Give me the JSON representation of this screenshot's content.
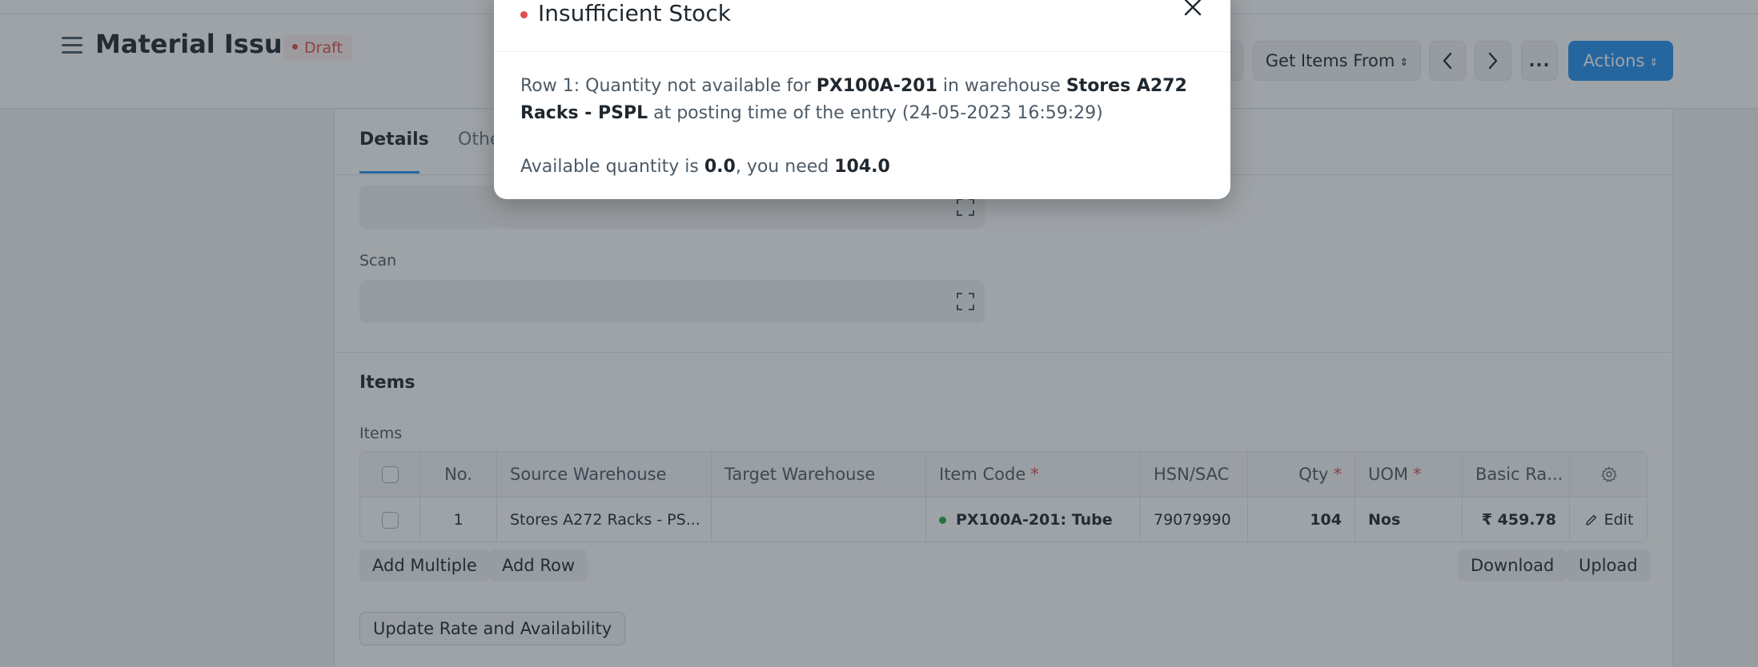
{
  "header": {
    "title": "Material Issue",
    "status": "Draft",
    "buttons": {
      "get_items_from": "Get Items From",
      "more": "...",
      "actions": "Actions"
    }
  },
  "tabs": [
    {
      "label": "Details",
      "active": true
    },
    {
      "label": "Othe",
      "active": false
    }
  ],
  "fields": {
    "scan_label": "Scan"
  },
  "items_section": {
    "title": "Items",
    "table_label": "Items",
    "columns": [
      "No.",
      "Source Warehouse",
      "Target Warehouse",
      "Item Code",
      "HSN/SAC",
      "Qty",
      "UOM",
      "Basic Ra..."
    ],
    "required_marker": "*",
    "rows": [
      {
        "no": "1",
        "source_warehouse": "Stores A272 Racks - PS...",
        "target_warehouse": "",
        "item_code": "PX100A-201: Tube",
        "hsn_sac": "79079990",
        "qty": "104",
        "uom": "Nos",
        "basic_rate": "₹ 459.78",
        "edit": "Edit"
      }
    ],
    "buttons": {
      "add_multiple": "Add Multiple",
      "add_row": "Add Row",
      "download": "Download",
      "upload": "Upload",
      "update_rate": "Update Rate and Availability"
    }
  },
  "modal": {
    "title": "Insufficient Stock",
    "line1": {
      "prefix": "Row 1: Quantity not available for ",
      "item": "PX100A-201",
      "mid": " in warehouse ",
      "warehouse": "Stores A272 Racks - PSPL",
      "suffix": " at posting time of the entry (24-05-2023 16:59:29)"
    },
    "line2": {
      "prefix": "Available quantity is ",
      "available": "0.0",
      "mid": ", you need ",
      "needed": "104.0"
    }
  },
  "colors": {
    "primary": "#2490ef",
    "danger": "#e24c4c",
    "success": "#28a745"
  }
}
